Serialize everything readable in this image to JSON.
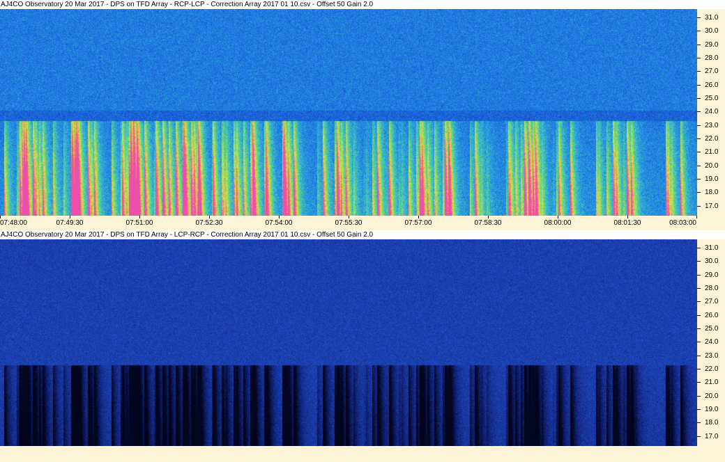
{
  "panels": [
    {
      "id": "top",
      "title": "AJ4CO Observatory 20 Mar 2017  -  DPS on TFD Array  -  RCP-LCP  -  Correction Array 2017 01 10.csv  -  Offset 50  Gain 2.0",
      "freq_labels": [
        "31.0",
        "30.0",
        "29.0",
        "28.0",
        "27.0",
        "26.0",
        "25.0",
        "24.0",
        "23.0",
        "22.0",
        "21.0",
        "20.0",
        "19.0",
        "18.0",
        "17.0"
      ],
      "time_labels": [
        "07:48:00",
        "07:49:30",
        "07:51:00",
        "07:52:30",
        "07:54:00",
        "07:55:30",
        "07:57:00",
        "07:58:30",
        "08:00:00",
        "08:01:30",
        "08:03:00"
      ],
      "palette": "rainbow"
    },
    {
      "id": "bottom",
      "title": "AJ4CO Observatory 20 Mar 2017  -  DPS on TFD Array  -  LCP-RCP  -  Correction Array 2017 01 10.csv  -  Offset 50  Gain 2.0",
      "freq_labels": [
        "31.0",
        "30.0",
        "29.0",
        "28.0",
        "27.0",
        "26.0",
        "25.0",
        "24.0",
        "23.0",
        "22.0",
        "21.0",
        "20.0",
        "19.0",
        "18.0",
        "17.0"
      ],
      "time_labels": [],
      "palette": "dark-blue"
    }
  ],
  "colors": {
    "axis_background": "#fdf3d6",
    "title_background": "#ffffff",
    "spectrogram_base": "#1f5fd0"
  }
}
